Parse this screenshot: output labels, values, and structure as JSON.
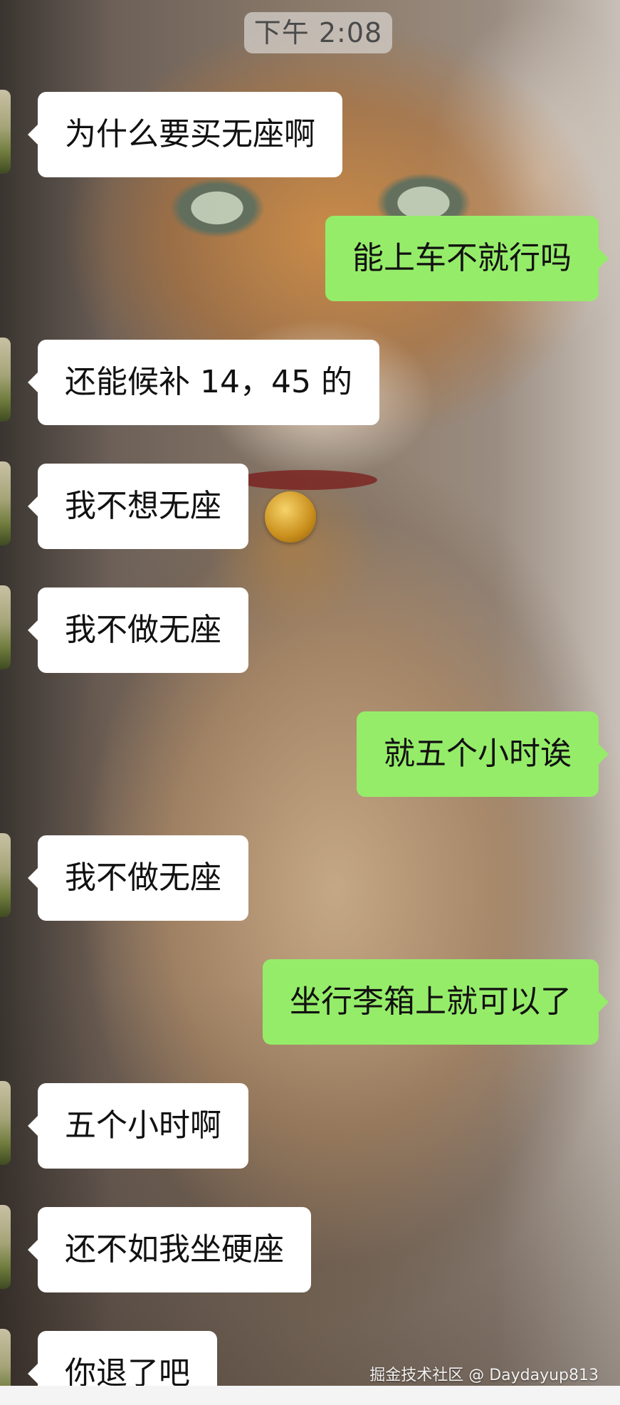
{
  "time_separator": "下午 2:08",
  "messages": [
    {
      "side": "in",
      "text": "为什么要买无座啊"
    },
    {
      "side": "out",
      "text": "能上车不就行吗"
    },
    {
      "side": "in",
      "text": "还能候补 14，45 的"
    },
    {
      "side": "in",
      "text": "我不想无座"
    },
    {
      "side": "in",
      "text": "我不做无座"
    },
    {
      "side": "out",
      "text": "就五个小时诶"
    },
    {
      "side": "in",
      "text": "我不做无座"
    },
    {
      "side": "out",
      "text": "坐行李箱上就可以了"
    },
    {
      "side": "in",
      "text": "五个小时啊"
    },
    {
      "side": "in",
      "text": "还不如我坐硬座"
    },
    {
      "side": "in",
      "text": "你退了吧"
    }
  ],
  "watermark": "掘金技术社区 @ Daydayup813",
  "colors": {
    "incoming_bubble": "#ffffff",
    "outgoing_bubble": "#95ec69"
  }
}
